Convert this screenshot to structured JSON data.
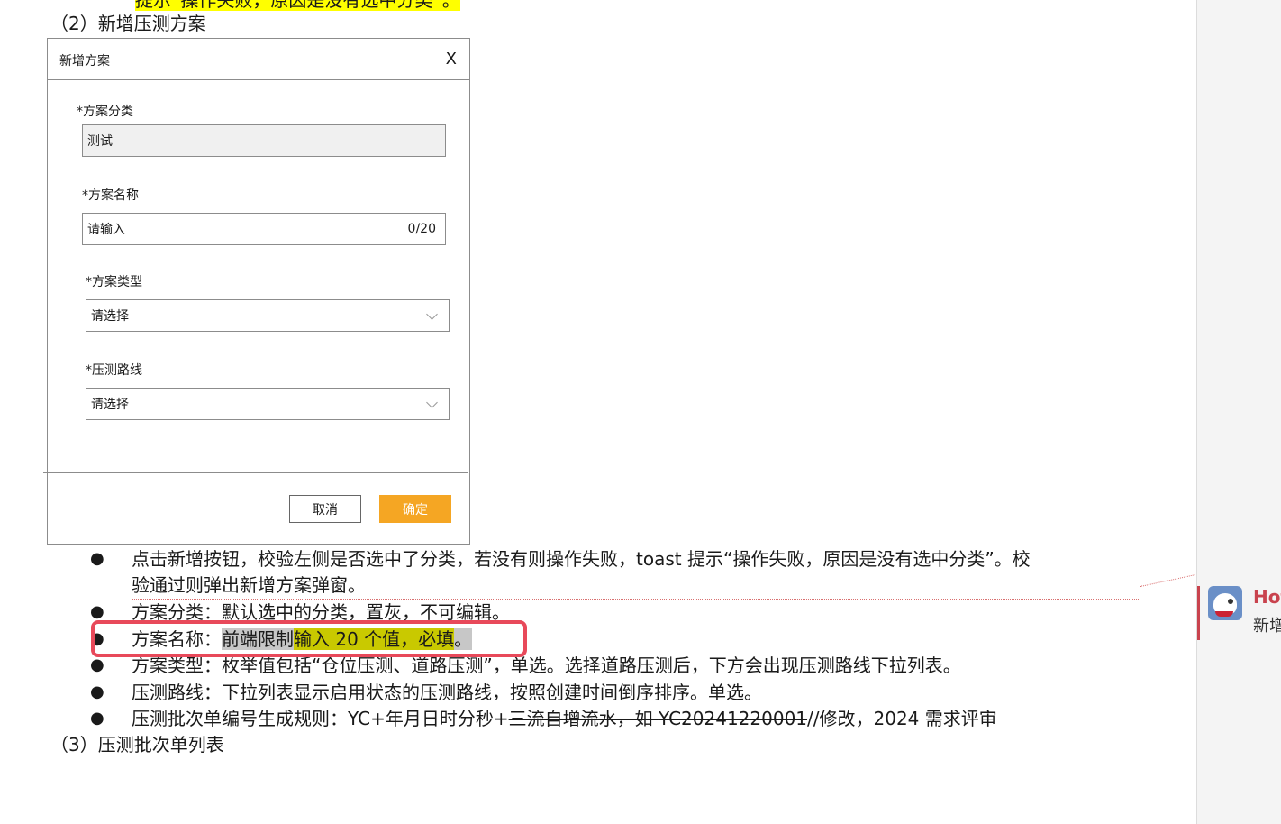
{
  "top_line": {
    "text": "提示“操作失败，原因是没有选中分类”。"
  },
  "headings": {
    "section2": "（2）新增压测方案",
    "section3": "（3）压测批次单列表"
  },
  "dialog": {
    "title": "新增方案",
    "close": "X",
    "fields": [
      {
        "label": "*方案分类",
        "value": "测试"
      },
      {
        "label": "*方案名称",
        "placeholder": "请输入",
        "counter": "0/20"
      },
      {
        "label": "*方案类型",
        "placeholder": "请选择"
      },
      {
        "label": "*压测路线",
        "placeholder": "请选择"
      }
    ],
    "cancel": "取消",
    "confirm": "确定"
  },
  "bullets": {
    "b1_part1": "点击新增按钮，校验左侧是否选中了分类，若没有则操作失败，toast 提示“操作失败，原因是没有选中分类”。校",
    "b1_part2": "验通过则弹出新增方案弹窗。",
    "b2": "方案分类：默认选中的分类，置灰，不可编辑。",
    "b3_prefix": "方案名称：",
    "b3_gray": "前端限制",
    "b3_olive": "输入 20 个值，必填",
    "b3_end": "。",
    "b4": "方案类型：枚举值包括“仓位压测、道路压测”，单选。选择道路压测后，下方会出现压测路线下拉列表。",
    "b5": "压测路线：下拉列表显示启用状态的压测路线，按照创建时间倒序排序。单选。",
    "b6_prefix": "压测批次单编号生成规则：YC+年月日时分秒+",
    "b6_strike1": "三流自增流水，如 ",
    "b6_strike2": "YC20241220001",
    "b6_suffix": "//修改，2024 需求评审"
  },
  "comment": {
    "author": "Hot",
    "text": "新增"
  },
  "colors": {
    "highlight_yellow": "#ffff00",
    "red_box": "#e8495a",
    "confirm_button": "#f5a623"
  }
}
